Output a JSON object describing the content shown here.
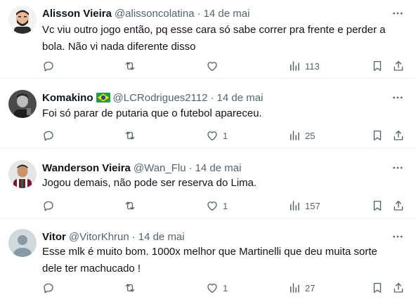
{
  "tweets": [
    {
      "name": "Alisson Vieira",
      "handle": "@alissoncolatina",
      "separator": "·",
      "date": "14 de mai",
      "text": "Vc viu outro jogo então, pq esse cara só sabe correr pra frente e perder a bola. Não vi nada diferente disso",
      "replies": "",
      "retweets": "",
      "likes": "",
      "views": "113",
      "avatar": "cartoon-man-avatar",
      "has_flag": false
    },
    {
      "name": "Komakino",
      "flag": "brazil-flag-emoji",
      "handle": "@LCRodrigues2112",
      "separator": "·",
      "date": "14 de mai",
      "text": "Foi só parar de putaria que o futebol apareceu.",
      "replies": "",
      "retweets": "",
      "likes": "1",
      "views": "25",
      "avatar": "bw-photo-avatar",
      "has_flag": true
    },
    {
      "name": "Wanderson Vieira",
      "handle": "@Wan_Flu",
      "separator": "·",
      "date": "14 de mai",
      "text": "Jogou demais, não pode ser reserva do Lima.",
      "replies": "",
      "retweets": "",
      "likes": "1",
      "views": "157",
      "avatar": "man-in-jersey-avatar",
      "has_flag": false
    },
    {
      "name": "Vitor",
      "handle": "@VitorKhrun",
      "separator": "·",
      "date": "14 de mai",
      "text": "Esse mlk é muito bom. 1000x melhor que Martinelli que deu muita sorte dele ter machucado !",
      "replies": "",
      "retweets": "",
      "likes": "1",
      "views": "27",
      "avatar": "default-avatar",
      "has_flag": false
    }
  ],
  "colors": {
    "text": "#0f1419",
    "secondary": "#536471",
    "divider": "#eff3f4"
  }
}
